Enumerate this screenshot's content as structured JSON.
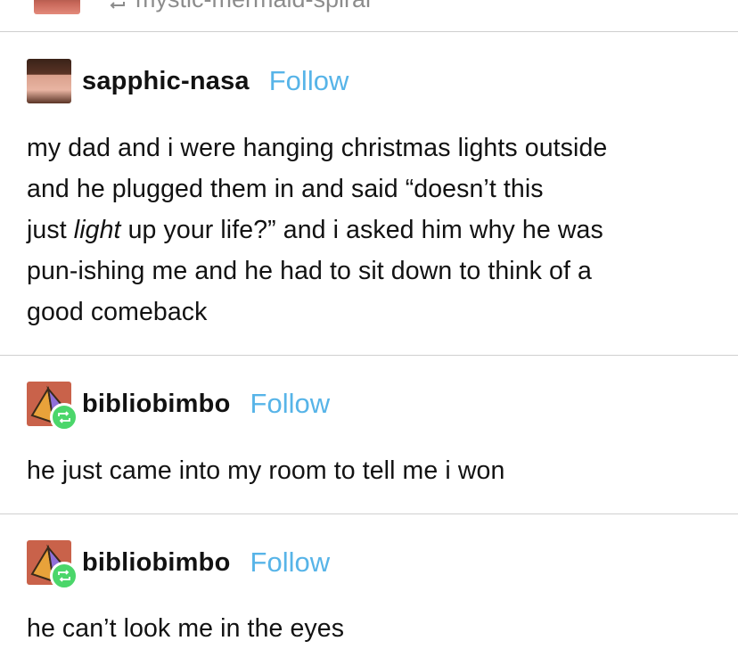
{
  "top_entry": {
    "username": "mystic-mermaid-spiral",
    "reblog_icon": "reblog-icon"
  },
  "posts": [
    {
      "username": "sapphic-nasa",
      "follow_label": "Follow",
      "text_lines": [
        "my dad and i were hanging christmas lights outside",
        "and he plugged them in and said “doesn’t this"
      ],
      "line3_before": "just ",
      "line3_em": "light",
      "line3_after": " up your life?” and i asked him why he was",
      "text_lines_end": [
        "pun-ishing me and he had to sit down to think of a",
        "good comeback"
      ]
    },
    {
      "username": "bibliobimbo",
      "follow_label": "Follow",
      "badge_icon": "reblog-icon",
      "text": "he just came into my room to tell me i won"
    },
    {
      "username": "bibliobimbo",
      "follow_label": "Follow",
      "badge_icon": "reblog-icon",
      "text": "he can’t look me in the eyes"
    }
  ],
  "colors": {
    "follow": "#57b4e8",
    "reblog_badge": "#4bd66a",
    "text": "#121212",
    "divider": "#cfcfcf"
  }
}
